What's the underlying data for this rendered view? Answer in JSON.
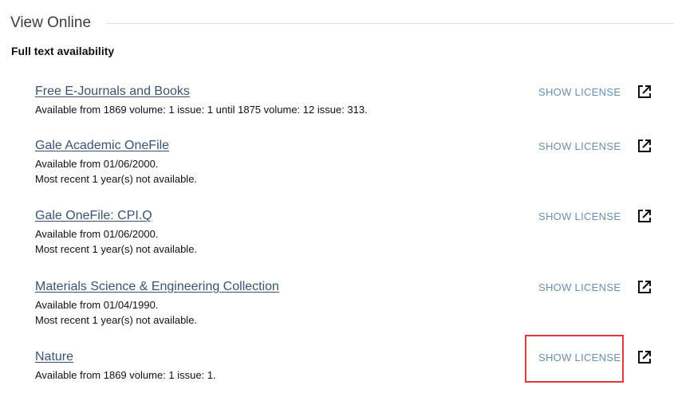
{
  "section": {
    "title": "View Online",
    "subheading": "Full text availability"
  },
  "services": [
    {
      "name": "Free E-Journals and Books",
      "lines": [
        "Available from 1869 volume: 1 issue: 1 until 1875 volume: 12 issue: 313."
      ],
      "license_label": "SHOW LICENSE",
      "link_icon": "external-link-icon"
    },
    {
      "name": "Gale Academic OneFile",
      "lines": [
        "Available from 01/06/2000.",
        "Most recent 1 year(s) not available."
      ],
      "license_label": "SHOW LICENSE",
      "link_icon": "external-link-icon"
    },
    {
      "name": "Gale OneFile: CPI.Q",
      "lines": [
        "Available from 01/06/2000.",
        "Most recent 1 year(s) not available."
      ],
      "license_label": "SHOW LICENSE",
      "link_icon": "external-link-icon"
    },
    {
      "name": "Materials Science & Engineering Collection",
      "lines": [
        "Available from 01/04/1990.",
        "Most recent 1 year(s) not available."
      ],
      "license_label": "SHOW LICENSE",
      "link_icon": "external-link-icon"
    },
    {
      "name": "Nature",
      "lines": [
        "Available from 1869 volume: 1 issue: 1."
      ],
      "license_label": "SHOW LICENSE",
      "link_icon": "external-link-icon"
    }
  ],
  "highlight": {
    "color": "#e0373b",
    "target": "Nature SHOW LICENSE"
  },
  "colors": {
    "link": "#3a5374",
    "license": "#6b8fb0"
  }
}
